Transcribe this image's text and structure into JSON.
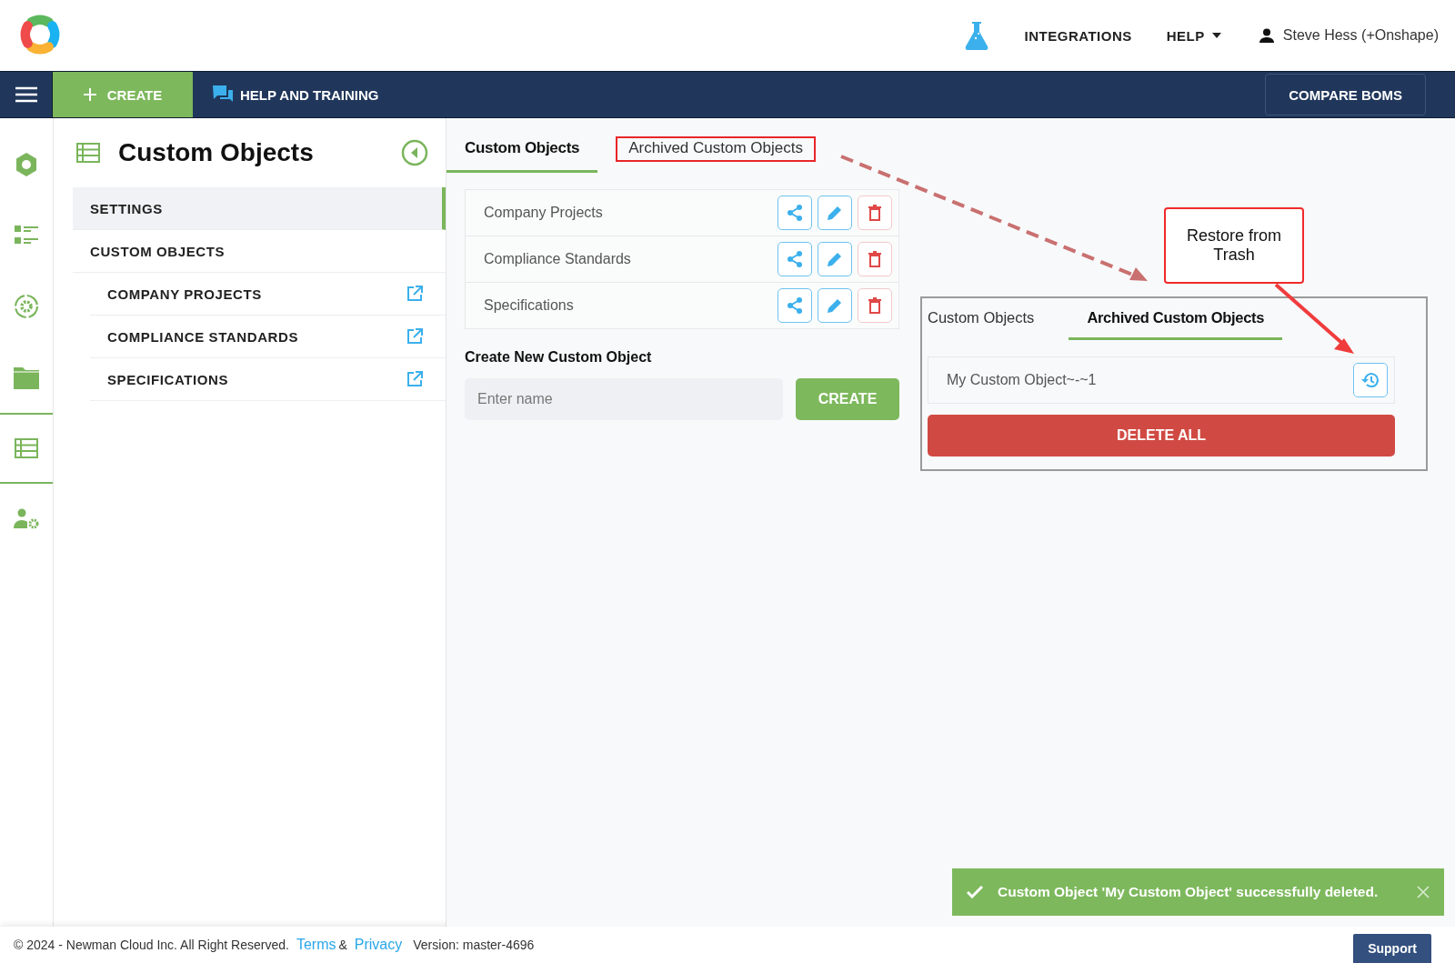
{
  "header": {
    "nav": [
      {
        "kind": "lab",
        "label": "INTEGRATIONS"
      },
      {
        "kind": "dropdown",
        "label": "HELP"
      },
      {
        "kind": "user",
        "label": "Steve Hess (+Onshape)"
      }
    ]
  },
  "toolbar": {
    "create": "CREATE",
    "help": "HELP AND TRAINING",
    "compare": "COMPARE BOMS"
  },
  "rail": [
    {
      "kind": "hexagon",
      "selected": false
    },
    {
      "kind": "list",
      "selected": false
    },
    {
      "kind": "cycle",
      "selected": false
    },
    {
      "kind": "folder",
      "selected": false
    },
    {
      "kind": "table",
      "selected": true
    },
    {
      "kind": "user-gear",
      "selected": false
    }
  ],
  "panel": {
    "title": "Custom Objects",
    "items": [
      {
        "label": "SETTINGS",
        "selected": true
      },
      {
        "label": "CUSTOM OBJECTS",
        "selected": false,
        "children": [
          {
            "label": "COMPANY PROJECTS"
          },
          {
            "label": "COMPLIANCE STANDARDS"
          },
          {
            "label": "SPECIFICATIONS"
          }
        ]
      }
    ]
  },
  "tabs": [
    {
      "label": "Custom Objects",
      "selected": true,
      "highlighted": false
    },
    {
      "label": "Archived Custom Objects",
      "selected": false,
      "highlighted": true
    }
  ],
  "objects": [
    {
      "name": "Company Projects"
    },
    {
      "name": "Compliance Standards"
    },
    {
      "name": "Specifications"
    }
  ],
  "create_form": {
    "heading": "Create New Custom Object",
    "placeholder": "Enter name",
    "button": "CREATE"
  },
  "inset": {
    "tabs": [
      {
        "label": "Custom Objects",
        "selected": false
      },
      {
        "label": "Archived Custom Objects",
        "selected": true
      }
    ],
    "items": [
      {
        "name": "My Custom Object~-~1"
      }
    ],
    "delete_all": "DELETE ALL"
  },
  "callout": "Restore from Trash",
  "toast": {
    "message": "Custom Object 'My Custom Object' successfully deleted."
  },
  "footer": {
    "copyright": "© 2024 - Newman Cloud Inc. All Right Reserved.",
    "terms": "Terms",
    "and": "&",
    "privacy": "Privacy",
    "version": "Version: master-4696",
    "support": "Support"
  }
}
